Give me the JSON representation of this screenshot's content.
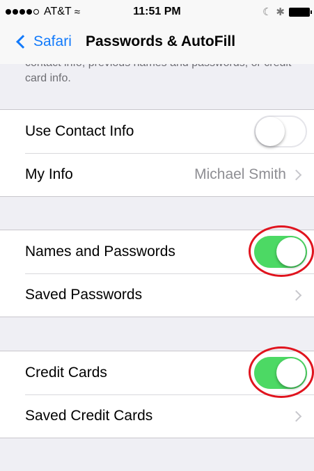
{
  "status_bar": {
    "carrier": "AT&T",
    "wifi_icon": "wifi-icon",
    "time": "11:51 PM",
    "bluetooth_icon": "bluetooth-icon",
    "battery_icon": "battery-icon"
  },
  "nav": {
    "back_label": "Safari",
    "title": "Passwords & AutoFill"
  },
  "description": "contact info, previous names and passwords, or credit card info.",
  "contact_group": {
    "use_contact_info": {
      "label": "Use Contact Info",
      "enabled": false
    },
    "my_info": {
      "label": "My Info",
      "value": "Michael Smith"
    }
  },
  "password_group": {
    "names_and_passwords": {
      "label": "Names and Passwords",
      "enabled": true
    },
    "saved_passwords": {
      "label": "Saved Passwords"
    }
  },
  "card_group": {
    "credit_cards": {
      "label": "Credit Cards",
      "enabled": true
    },
    "saved_credit_cards": {
      "label": "Saved Credit Cards"
    }
  },
  "colors": {
    "accent": "#127afb",
    "switch_on": "#4cd964",
    "highlight_circle": "#e0141e"
  }
}
